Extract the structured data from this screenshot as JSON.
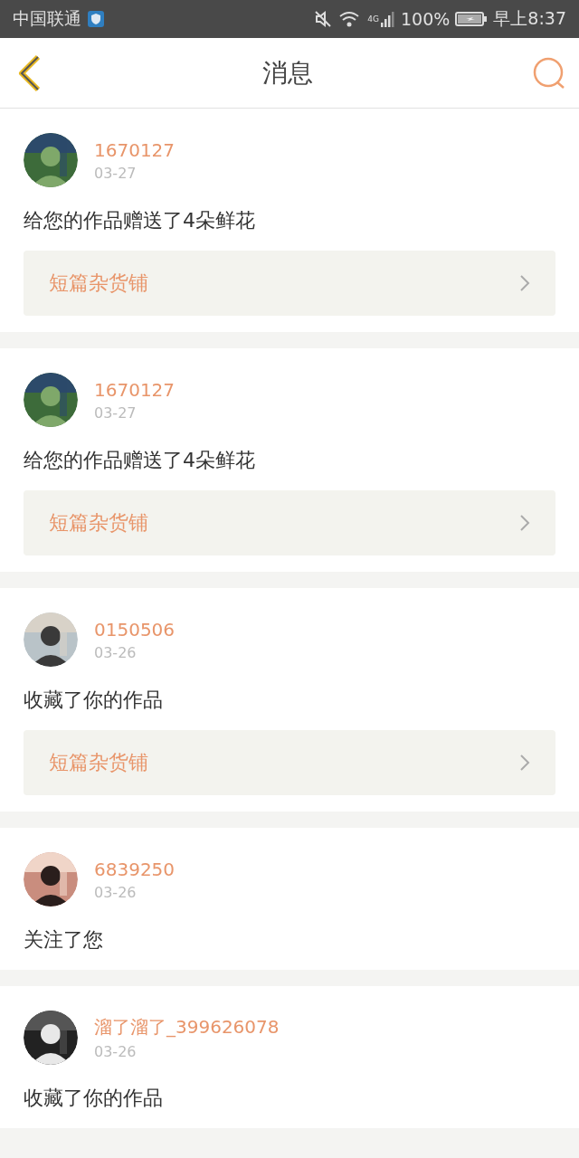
{
  "status_bar": {
    "carrier": "中国联通",
    "network": "4G",
    "battery": "100%",
    "time": "早上8:37"
  },
  "header": {
    "title": "消息"
  },
  "messages": [
    {
      "user": "1670127",
      "date": "03-27",
      "text": "给您的作品赠送了4朵鲜花",
      "work": "短篇杂货铺"
    },
    {
      "user": "1670127",
      "date": "03-27",
      "text": "给您的作品赠送了4朵鲜花",
      "work": "短篇杂货铺"
    },
    {
      "user": "0150506",
      "date": "03-26",
      "text": "收藏了你的作品",
      "work": "短篇杂货铺"
    },
    {
      "user": "6839250",
      "date": "03-26",
      "text": "关注了您"
    },
    {
      "user": "溜了溜了_399626078",
      "date": "03-26",
      "text": "收藏了你的作品"
    }
  ]
}
